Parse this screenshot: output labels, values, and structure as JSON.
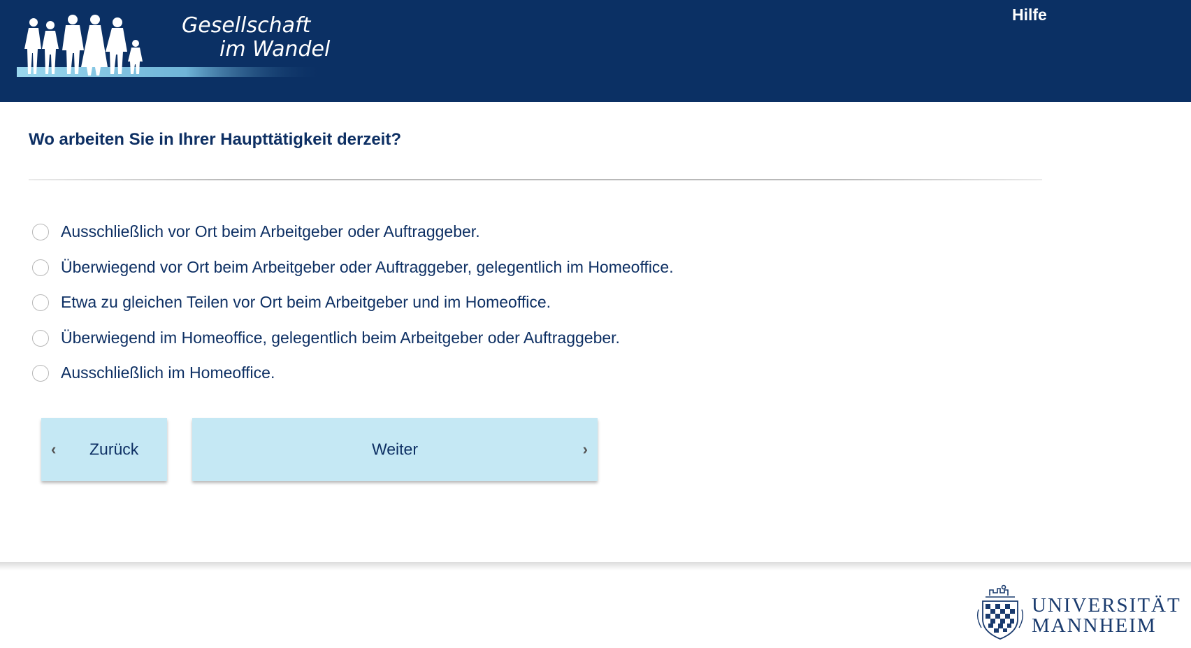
{
  "header": {
    "logo": {
      "line1": "Gesellschaft",
      "line2": "im Wandel"
    },
    "help_label": "Hilfe",
    "colors": {
      "background": "#0b3064",
      "text": "#ffffff"
    }
  },
  "question": {
    "title": "Wo arbeiten Sie in Ihrer Haupttätigkeit derzeit?",
    "options": [
      {
        "label": "Ausschließlich vor Ort beim Arbeitgeber oder Auftraggeber.",
        "selected": false
      },
      {
        "label": "Überwiegend vor Ort beim Arbeitgeber oder Auftraggeber, gelegentlich im Homeoffice.",
        "selected": false
      },
      {
        "label": "Etwa zu gleichen Teilen vor Ort beim Arbeitgeber und im Homeoffice.",
        "selected": false
      },
      {
        "label": "Überwiegend im Homeoffice, gelegentlich beim Arbeitgeber oder Auftraggeber.",
        "selected": false
      },
      {
        "label": "Ausschließlich im Homeoffice.",
        "selected": false
      }
    ]
  },
  "navigation": {
    "back_label": "Zurück",
    "next_label": "Weiter",
    "back_icon": "chevron-left-icon",
    "next_icon": "chevron-right-icon",
    "button_color": "#c5e8f4"
  },
  "footer": {
    "university_line1": "UNIVERSITÄT",
    "university_line2": "MANNHEIM"
  },
  "colors": {
    "text": "#0d2f63"
  }
}
